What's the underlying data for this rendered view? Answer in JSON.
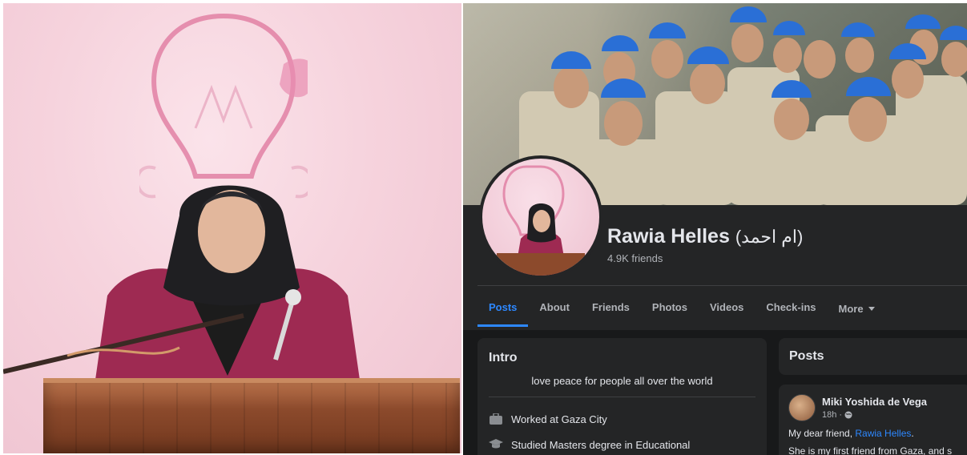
{
  "profile": {
    "name": "Rawia Helles",
    "name_arabic": "(ام احمد)",
    "friends": "4.9K friends"
  },
  "tabs": [
    {
      "label": "Posts",
      "active": true
    },
    {
      "label": "About",
      "active": false
    },
    {
      "label": "Friends",
      "active": false
    },
    {
      "label": "Photos",
      "active": false
    },
    {
      "label": "Videos",
      "active": false
    },
    {
      "label": "Check-ins",
      "active": false
    },
    {
      "label": "More",
      "active": false
    }
  ],
  "intro": {
    "title": "Intro",
    "bio": "love peace for people all over the world",
    "work": "Worked at Gaza City",
    "education": "Studied Masters degree in Educational"
  },
  "posts": {
    "title": "Posts",
    "author": "Miki Yoshida de Vega",
    "time": "18h",
    "line1_prefix": "My dear friend, ",
    "line1_mention": "Rawia Helles",
    "line1_suffix": ".",
    "line2": "She is my first friend from Gaza, and s"
  },
  "icons": {
    "work": "briefcase-icon",
    "education": "graduation-cap-icon",
    "audience": "globe-icon",
    "more": "caret-down-icon"
  },
  "colors": {
    "accent": "#2d88ff",
    "card": "#242526",
    "background": "#18191a",
    "helmet": "#2a6fd6",
    "blazer": "#9e2a52"
  }
}
